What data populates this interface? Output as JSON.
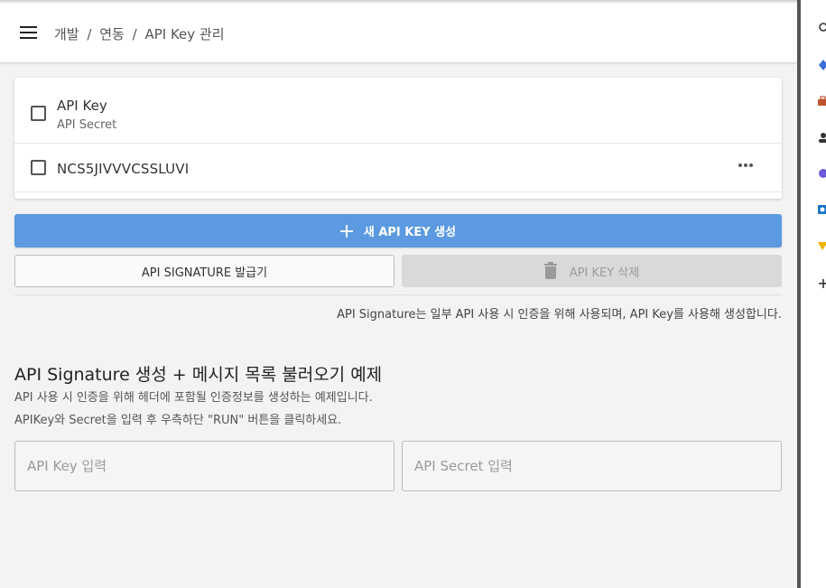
{
  "breadcrumb": {
    "part1": "개발",
    "sep1": "/",
    "part2": "연동",
    "sep2": "/",
    "part3": "API Key 관리"
  },
  "table": {
    "header_title": "API Key",
    "header_subtitle": "API Secret",
    "rows": [
      {
        "key": "NCS5JIVVVCSSLUVI"
      }
    ]
  },
  "actions": {
    "create_label": "새 API KEY 생성",
    "signature_label": "API SIGNATURE 발급기",
    "delete_label": "API KEY 삭제"
  },
  "note": "API Signature는 일부 API 사용 시 인증을 위해 사용되며, API Key를 사용해 생성합니다.",
  "example": {
    "title": "API Signature 생성 + 메시지 목록 불러오기 예제",
    "desc1": "API 사용 시 인증을 위해 헤더에 포함될 인증정보를 생성하는 예제입니다.",
    "desc2": "APIKey와 Secret을 입력 후 우측하단 \"RUN\" 버튼을 클릭하세요.",
    "api_key_placeholder": "API Key 입력",
    "api_secret_placeholder": "API Secret 입력"
  },
  "colors": {
    "primary": "#5b9ae0",
    "disabled_bg": "#d9d9d9",
    "side_icons": [
      "#3b6fd8",
      "#4a7ee6",
      "#c0532e",
      "#333333",
      "#6b5bd8",
      "#1a73c9",
      "#f0b400",
      "#333333"
    ]
  },
  "side_icons": [
    "search-icon",
    "diamond-icon",
    "briefcase-icon",
    "person-icon",
    "copilot-icon",
    "outlook-icon",
    "games-icon",
    "plus-icon"
  ]
}
